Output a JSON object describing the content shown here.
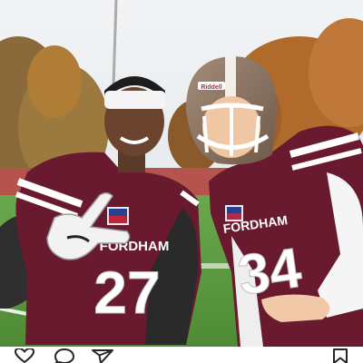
{
  "post": {
    "photo": {
      "subject": "two-football-players",
      "jersey_wordmark_left": "FORDHAM",
      "jersey_wordmark_right": "FORDHAM",
      "jersey_number_left": "27",
      "jersey_number_right": "34",
      "helmet_decal": "Riddell"
    },
    "actions": {
      "like_icon": "heart-outline-icon",
      "comment_icon": "speech-bubble-icon",
      "share_icon": "paper-plane-icon",
      "save_icon": "bookmark-outline-icon"
    }
  },
  "colors": {
    "jersey_maroon": "#6a1a2e",
    "jersey_stripe": "#ffffff",
    "field_green": "#5f9b3d",
    "sky": "#e9ecef",
    "icon": "#262626"
  }
}
